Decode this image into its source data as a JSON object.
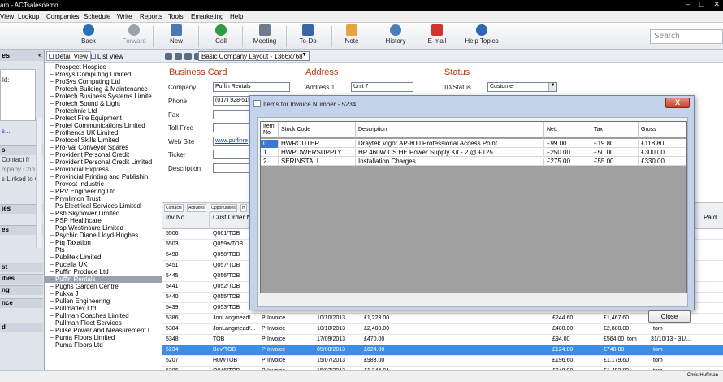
{
  "window": {
    "title": "am - ACTsalesdemo"
  },
  "menu": [
    "View",
    "Lookup",
    "Companies",
    "Schedule",
    "Write",
    "Reports",
    "Tools",
    "Emarketing",
    "Help"
  ],
  "toolbar": {
    "buttons": [
      {
        "label": "Back",
        "icon": "back-arrow-icon",
        "color": "#2e6fb8"
      },
      {
        "label": "Forward",
        "icon": "forward-arrow-icon",
        "color": "#9aa2ad"
      },
      {
        "label": "New",
        "icon": "new-document-icon",
        "color": "#4a79b6"
      },
      {
        "label": "Call",
        "icon": "phone-icon",
        "color": "#2f9a43"
      },
      {
        "label": "Meeting",
        "icon": "meeting-icon",
        "color": "#6e7b8c"
      },
      {
        "label": "To-Do",
        "icon": "checklist-icon",
        "color": "#3b64a8"
      },
      {
        "label": "Note",
        "icon": "note-icon",
        "color": "#e7a33c"
      },
      {
        "label": "History",
        "icon": "history-icon",
        "color": "#4a7db8"
      },
      {
        "label": "E-mail",
        "icon": "email-icon",
        "color": "#d0352d"
      },
      {
        "label": "Help Topics",
        "icon": "help-icon",
        "color": "#2f66b5"
      }
    ],
    "search_placeholder": "Search"
  },
  "left_panel": {
    "header": "es",
    "collapse_glyph": "«",
    "box_line": "ld:",
    "more_link": "s...",
    "sections": [
      {
        "label": "s"
      },
      {
        "label": "Contact fr"
      },
      {
        "label": "mpany Con"
      },
      {
        "label": "s Linked to C"
      },
      {
        "label": "ies"
      },
      {
        "label": "es"
      },
      {
        "label": "st"
      },
      {
        "label": "ities"
      },
      {
        "label": "ng"
      },
      {
        "label": "nce"
      },
      {
        "label": "d"
      }
    ]
  },
  "company_list": {
    "tabs": {
      "detail": "Detail View",
      "list": "List View"
    },
    "items": [
      "Prospect Hospice",
      "Prosys Computing Limited",
      "ProSys Computing Ltd",
      "Protech Building & Maintenance",
      "Protech Business Systems Limite",
      "Protech Sound & Light",
      "Protechnic Ltd",
      "Protect Fire Equipment",
      "Profel Communications Limited",
      "Prothencs UK Limited",
      "Protocol Skills Limited",
      "Pro-Val Conveyor Spares",
      "Provident Personal Credit",
      "Provident Personal Credit Limited",
      "Provincial Express",
      "Provincial Printing and Publishin",
      "Provost Industrie",
      "PRV Engineering Ltd",
      "Prynlimon Trust",
      "Ps Electrical Services Limited",
      "Psh Skypower Limited",
      "PSP Healthcare",
      "Psp Westinsure Limited",
      "Psychic Diane Lloyd-Hughes",
      "Ptq Taxation",
      "Pts",
      "Publitek Limited",
      "Pucella UK",
      "Puffin Produce Ltd",
      "Puffin Rentals",
      "Pughs Garden Centre",
      "Pukka J",
      "Pullen Engineering",
      "Pullmaflex Ltd",
      "Pullman Coaches Limited",
      "Pullman Fleet Services",
      "Pulse Power and Measurement L",
      "Puma Floors Limited",
      "Puma Floors Ltd"
    ],
    "selected_index": 29
  },
  "layout_select": "Basic Company Layout - 1366x768",
  "business_card": {
    "title": "Business Card",
    "company_label": "Company",
    "company": "Puffin Rentals",
    "phone_label": "Phone",
    "phone": "(017) 928-515",
    "fax_label": "Fax",
    "tollfree_label": "Toll-Free",
    "web_label": "Web Site",
    "web": "www.puffinre",
    "ticker_label": "Ticker",
    "description_label": "Description"
  },
  "address": {
    "title": "Address",
    "address1_label": "Address 1",
    "address1": "Unit 7"
  },
  "status": {
    "title": "Status",
    "id_label": "ID/Status",
    "id_value": "Customer"
  },
  "subtabs": [
    "Contacts",
    "Activities",
    "Opportunities",
    "H"
  ],
  "invoice_grid": {
    "headers": {
      "inv": "Inv No",
      "cust": "Cust Order No",
      "paid": "Paid"
    },
    "rows": [
      {
        "inv": "5506",
        "cust": "Q061/TOB"
      },
      {
        "inv": "5503",
        "cust": "Q059a/TOB"
      },
      {
        "inv": "5498",
        "cust": "Q058/TOB"
      },
      {
        "inv": "5451",
        "cust": "Q057/TOB"
      },
      {
        "inv": "5445",
        "cust": "Q056/TOB"
      },
      {
        "inv": "5441",
        "cust": "Q052/TOB"
      },
      {
        "inv": "5440",
        "cust": "Q055/TOB"
      },
      {
        "inv": "5439",
        "cust": "Q053/TOB"
      },
      {
        "inv": "5386",
        "cust": "JonLangmead/...",
        "p": "P",
        "type": "Invoice",
        "date": "10/10/2013",
        "amount": "£1,223.00",
        "vat": "£244.60",
        "gross": "£1,467.60",
        "who": "tom",
        "paid": ""
      },
      {
        "inv": "5384",
        "cust": "JonLangmead/...",
        "p": "P",
        "type": "Invoice",
        "date": "10/10/2013",
        "amount": "£2,400.00",
        "vat": "£480.00",
        "gross": "£2,880.00",
        "who": "tom",
        "paid": ""
      },
      {
        "inv": "5348",
        "cust": "TOB",
        "p": "P",
        "type": "Invoice",
        "date": "17/09/2013",
        "amount": "£470.00",
        "vat": "£94.00",
        "gross": "£564.00",
        "who": "tom",
        "paid": "31/10/13 - 31/..."
      },
      {
        "inv": "5234",
        "cust": "Bev/TOB",
        "p": "P",
        "type": "Invoice",
        "date": "05/08/2013",
        "amount": "£624.00",
        "vat": "£124.80",
        "gross": "£748.80",
        "who": "tom",
        "paid": ""
      },
      {
        "inv": "5207",
        "cust": "Huw/TOB",
        "p": "P",
        "type": "Invoice",
        "date": "15/07/2013",
        "amount": "£983.00",
        "vat": "£196.60",
        "gross": "£1,179.60",
        "who": "tom",
        "paid": ""
      },
      {
        "inv": "5206",
        "cust": "Q046/TOB",
        "p": "P",
        "type": "Invoice",
        "date": "15/07/2013",
        "amount": "£1,244.91",
        "vat": "£248.98",
        "gross": "£1,493.89",
        "who": "tom",
        "paid": ""
      }
    ],
    "selected_index": 11
  },
  "dialog": {
    "title": "Items for Invoice Number - 5234",
    "headers": {
      "item": "Item No",
      "stock": "Stock Code",
      "desc": "Description",
      "net": "Nett",
      "tax": "Tax",
      "gross": "Gross"
    },
    "rows": [
      {
        "item": "0",
        "stock": "HWROUTER",
        "desc": "Draytek Vigor AP-800 Professional Access Point",
        "net": "£99.00",
        "tax": "£19.80",
        "gross": "£118.80"
      },
      {
        "item": "1",
        "stock": "HWPOWERSUPPLY",
        "desc": "HP 460W CS HE Power Supply Kit - 2 @ £125",
        "net": "£250.00",
        "tax": "£50.00",
        "gross": "£300.00"
      },
      {
        "item": "2",
        "stock": "SERINSTALL",
        "desc": "Installation Charges",
        "net": "£275.00",
        "tax": "£55.00",
        "gross": "£330.00"
      }
    ],
    "close_label": "Close",
    "close_glyph": "X"
  },
  "status_bar": {
    "user": "Chris Huffman"
  }
}
